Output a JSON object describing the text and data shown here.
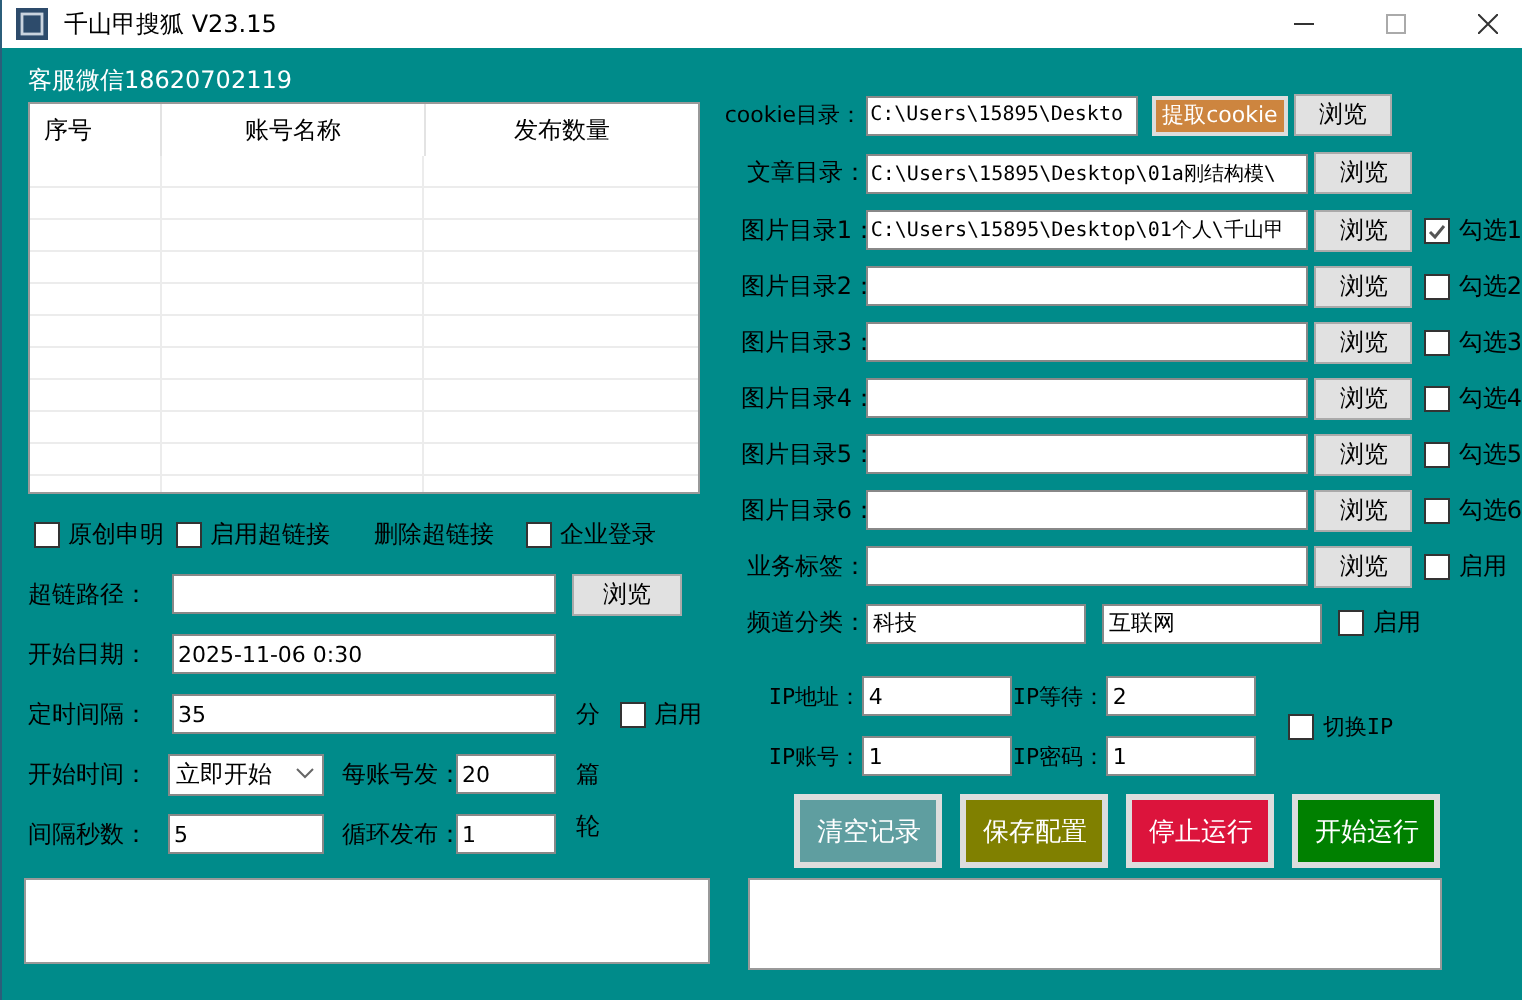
{
  "window": {
    "title": "千山甲搜狐 V23.15"
  },
  "contact": "客服微信18620702119",
  "table": {
    "columns": [
      "序号",
      "账号名称",
      "发布数量"
    ]
  },
  "options": [
    {
      "label": "原创申明",
      "kind": "checkbox",
      "checked": false
    },
    {
      "label": "启用超链接",
      "kind": "checkbox",
      "checked": false
    },
    {
      "label": "删除超链接",
      "kind": "text"
    },
    {
      "label": "企业登录",
      "kind": "checkbox",
      "checked": false
    }
  ],
  "link_path": {
    "label": "超链路径：",
    "button": "浏览"
  },
  "start_date": {
    "label": "开始日期：",
    "value": "2025-11-06 0:30"
  },
  "interval": {
    "label": "定时间隔：",
    "value": "35",
    "unit": "分",
    "enable": {
      "label": "启用",
      "checked": false
    }
  },
  "start_time": {
    "label": "开始时间：",
    "value": "立即开始"
  },
  "per_account": {
    "label": "每账号发：",
    "value": "20",
    "unit": "篇"
  },
  "interval_seconds": {
    "label": "间隔秒数：",
    "value": "5"
  },
  "loop": {
    "label": "循环发布：",
    "value": "1",
    "unit": "轮"
  },
  "cookie_dir": {
    "label": "cookie目录：",
    "value": "C:\\Users\\15895\\Deskto",
    "extract_button": "提取cookie",
    "browse_button": "浏览"
  },
  "article_dir": {
    "label": "文章目录：",
    "value": "C:\\Users\\15895\\Desktop\\01a刚结构模\\",
    "button": "浏览"
  },
  "image_dirs": [
    {
      "label": "图片目录1：",
      "value": "C:\\Users\\15895\\Desktop\\01个人\\千山甲",
      "button": "浏览",
      "check": {
        "label": "勾选1",
        "checked": true
      }
    },
    {
      "label": "图片目录2：",
      "button": "浏览",
      "check": {
        "label": "勾选2",
        "checked": false
      }
    },
    {
      "label": "图片目录3：",
      "button": "浏览",
      "check": {
        "label": "勾选3",
        "checked": false
      }
    },
    {
      "label": "图片目录4：",
      "button": "浏览",
      "check": {
        "label": "勾选4",
        "checked": false
      }
    },
    {
      "label": "图片目录5：",
      "button": "浏览",
      "check": {
        "label": "勾选5",
        "checked": false
      }
    },
    {
      "label": "图片目录6：",
      "button": "浏览",
      "check": {
        "label": "勾选6",
        "checked": false
      }
    }
  ],
  "tags": {
    "label": "业务标签：",
    "button": "浏览",
    "enable": {
      "label": "启用",
      "checked": false
    }
  },
  "channel": {
    "label": "频道分类：",
    "values": [
      "科技",
      "互联网"
    ],
    "enable": {
      "label": "启用",
      "checked": false
    }
  },
  "ip": {
    "fields": [
      {
        "label": "IP地址：",
        "value": "4"
      },
      {
        "label": "IP等待：",
        "value": "2"
      },
      {
        "label": "IP账号：",
        "value": "1"
      },
      {
        "label": "IP密码：",
        "value": "1"
      }
    ],
    "switch": {
      "label": "切换IP",
      "checked": false
    }
  },
  "actions": [
    {
      "label": "清空记录",
      "color": "#5f9ea0"
    },
    {
      "label": "保存配置",
      "color": "#808000"
    },
    {
      "label": "停止运行",
      "color": "#dc143c"
    },
    {
      "label": "开始运行",
      "color": "#008000"
    }
  ]
}
